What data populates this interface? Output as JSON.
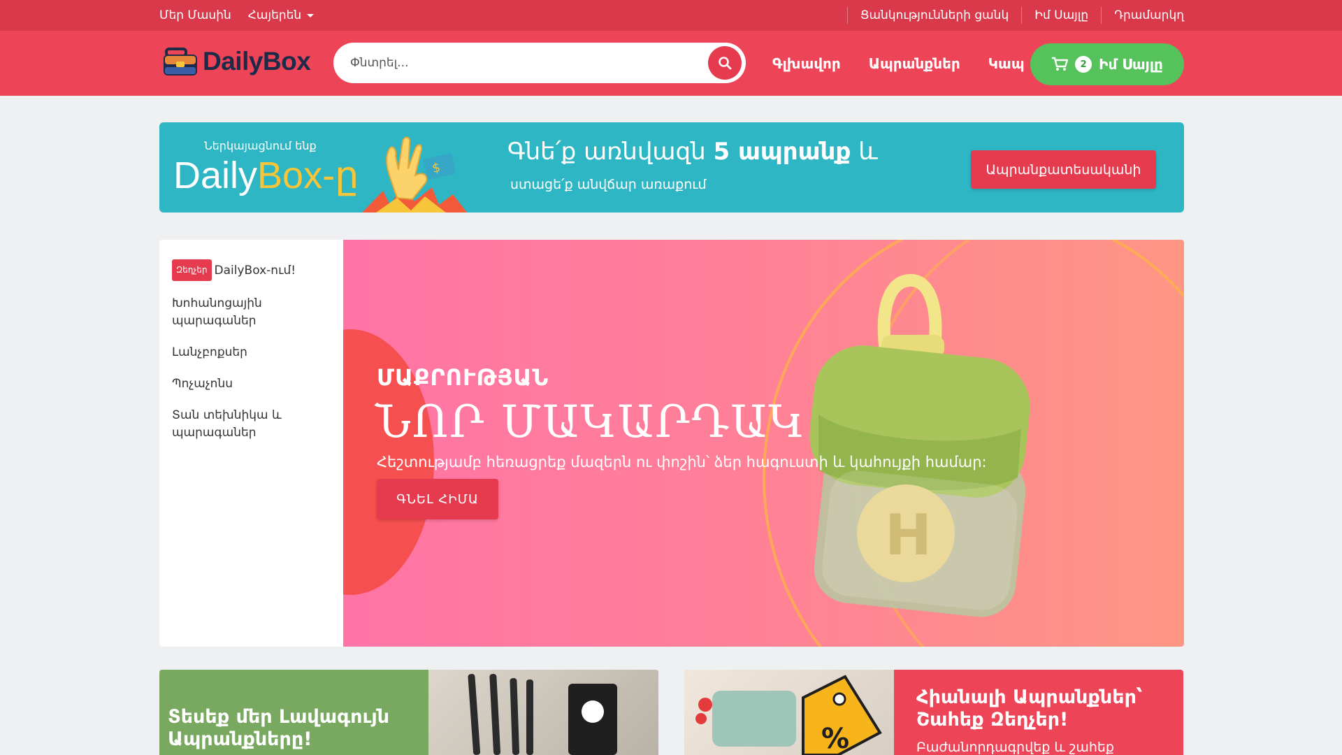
{
  "topbar": {
    "about": "Մեր Մասին",
    "language": "Հայերեն",
    "wishlist": "Ցանկությունների ցանկ",
    "my_cart": "Իմ Սայլը",
    "checkout": "Դրամարկղ"
  },
  "header": {
    "logo_text": "DailyBox",
    "search_placeholder": "Փնտրել...",
    "nav": [
      "Գլխավոր",
      "Ապրանքներ",
      "Կապ"
    ],
    "cart_count": "2",
    "cart_label": "Իմ Սայլը"
  },
  "promo": {
    "intro": "Ներկայացնում ենք",
    "brand_main": "Daily",
    "brand_accent": "Box-ը",
    "headline_pre": "Գնե՛ք առնվազն",
    "headline_bold": "5 ապրանք",
    "headline_post": "և",
    "subline": "ստացե՛ք անվճար առաքում",
    "button": "Ապրանքատեսականի"
  },
  "sidebar": {
    "sale_badge": "Զեղչեր",
    "sale_label": "DailyBox-ում!",
    "items": [
      "Խոհանոցային պարագաներ",
      "Լանչբոքսեր",
      "Պոչաչոնս",
      "Տան տեխնիկա և պարագաներ"
    ]
  },
  "hero": {
    "eyebrow": "ՄԱՔՐՈՒԹՅԱՆ",
    "title": "ՆՈՐ ՄԱԿԱՐԴԱԿ",
    "description": "Հեշտությամբ հեռացրեք մազերն ու փոշին՝ ձեր հագուստի և կահույքի համար:",
    "button": "ԳՆԵԼ ՀԻՄԱ",
    "product_letter": "H"
  },
  "cards": {
    "left_title": "Տեսեք մեր Լավագույն Ապրանքները!",
    "right_title": "Հիանալի Ապրանքներ՝ Շահեք Զեղչեր!",
    "right_sub": "Բաժանորդագրվեք և շահեք"
  },
  "colors": {
    "topbar": "#d9394b",
    "header": "#ee4458",
    "accent": "#e63a4e",
    "cart_green": "#56c25c",
    "promo_teal": "#2eb6c4"
  }
}
